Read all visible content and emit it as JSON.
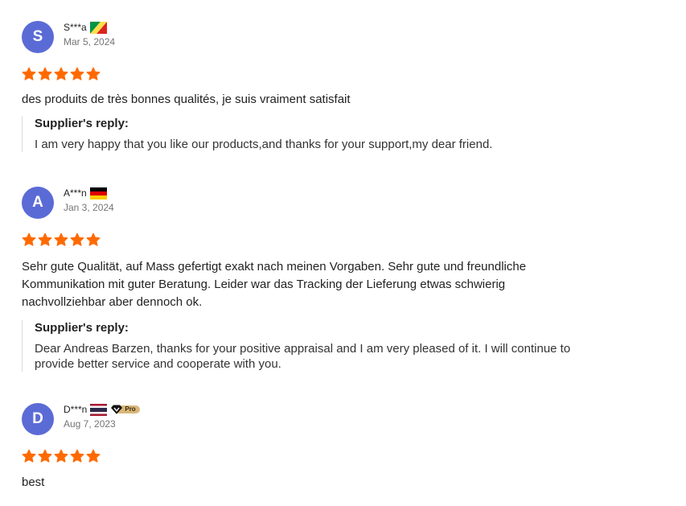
{
  "reviews": [
    {
      "avatar_letter": "S",
      "name": "S***a",
      "flag": "congo-flag-icon",
      "date": "Mar 5, 2024",
      "rating": 5,
      "comment": "des produits de très bonnes qualités, je suis vraiment satisfait",
      "reply_title": "Supplier's reply:",
      "reply_text": "I am very happy that you like our products,and thanks for your support,my dear friend."
    },
    {
      "avatar_letter": "A",
      "name": "A***n",
      "flag": "germany-flag-icon",
      "date": "Jan 3, 2024",
      "rating": 5,
      "comment_lines": [
        "Sehr gute Qualität, auf Mass gefertigt exakt nach meinen Vorgaben. Sehr gute und freundliche",
        "Kommunikation mit guter Beratung. Leider war das Tracking der Lieferung etwas schwierig",
        "nachvollziehbar aber dennoch ok."
      ],
      "reply_title": "Supplier's reply:",
      "reply_lines": [
        "Dear Andreas Barzen, thanks for your positive appraisal and I am very pleased of it. I will continue to",
        "provide better service and cooperate with you."
      ]
    },
    {
      "avatar_letter": "D",
      "name": "D***n",
      "flag": "thailand-flag-icon",
      "badge": "Pro",
      "date": "Aug 7, 2023",
      "rating": 5,
      "comment": "best"
    }
  ],
  "colors": {
    "avatar_bg": "#5b6bd6",
    "star": "#ff6a00",
    "muted_text": "#757575",
    "reply_border": "#dddddd",
    "badge_gold": "#d9b77a"
  }
}
